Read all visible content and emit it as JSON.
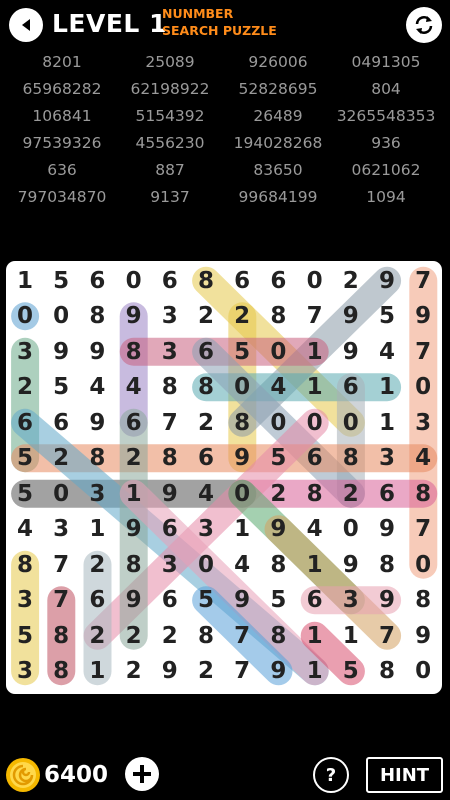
{
  "header": {
    "level_word": "LEVEL",
    "level_number": "1",
    "title_line1": "NUNMBER",
    "title_line2": "SEARCH PUZZLE"
  },
  "targets": [
    [
      "8201",
      "25089",
      "926006",
      "0491305"
    ],
    [
      "65968282",
      "62198922",
      "52828695",
      "804"
    ],
    [
      "106841",
      "5154392",
      "26489",
      "3265548353"
    ],
    [
      "97539326",
      "4556230",
      "194028268",
      "936"
    ],
    [
      "636",
      "887",
      "83650",
      "0621062"
    ],
    [
      "797034870",
      "9137",
      "99684199",
      "1094"
    ]
  ],
  "grid": [
    [
      "1",
      "5",
      "6",
      "0",
      "6",
      "8",
      "6",
      "6",
      "0",
      "2",
      "9",
      "7"
    ],
    [
      "0",
      "0",
      "8",
      "9",
      "3",
      "2",
      "2",
      "8",
      "7",
      "9",
      "5",
      "9"
    ],
    [
      "3",
      "9",
      "9",
      "8",
      "3",
      "6",
      "5",
      "0",
      "1",
      "9",
      "4",
      "7"
    ],
    [
      "2",
      "5",
      "4",
      "4",
      "8",
      "8",
      "0",
      "4",
      "1",
      "6",
      "1",
      "0"
    ],
    [
      "6",
      "6",
      "9",
      "6",
      "7",
      "2",
      "8",
      "0",
      "0",
      "0",
      "1",
      "3"
    ],
    [
      "5",
      "2",
      "8",
      "2",
      "8",
      "6",
      "9",
      "5",
      "6",
      "8",
      "3",
      "4"
    ],
    [
      "5",
      "0",
      "3",
      "1",
      "9",
      "4",
      "0",
      "2",
      "8",
      "2",
      "6",
      "8"
    ],
    [
      "4",
      "3",
      "1",
      "9",
      "6",
      "3",
      "1",
      "9",
      "4",
      "0",
      "9",
      "7"
    ],
    [
      "8",
      "7",
      "2",
      "8",
      "3",
      "0",
      "4",
      "8",
      "1",
      "9",
      "8",
      "0"
    ],
    [
      "3",
      "7",
      "6",
      "9",
      "6",
      "5",
      "9",
      "5",
      "6",
      "3",
      "9",
      "8"
    ],
    [
      "5",
      "8",
      "2",
      "2",
      "2",
      "8",
      "7",
      "8",
      "1",
      "1",
      "7",
      "9"
    ],
    [
      "3",
      "8",
      "1",
      "2",
      "9",
      "2",
      "7",
      "9",
      "1",
      "5",
      "8",
      "0"
    ]
  ],
  "highlights": [
    {
      "color": "#e6c84a",
      "from": [
        0,
        5
      ],
      "to": [
        4,
        9
      ]
    },
    {
      "color": "#f0a080",
      "from": [
        0,
        11
      ],
      "to": [
        8,
        11
      ]
    },
    {
      "color": "#5a9ed0",
      "from": [
        1,
        0
      ],
      "to": [
        1,
        0
      ]
    },
    {
      "color": "#9a84c4",
      "from": [
        1,
        3
      ],
      "to": [
        4,
        3
      ]
    },
    {
      "color": "#e6c84a",
      "from": [
        1,
        6
      ],
      "to": [
        5,
        6
      ]
    },
    {
      "color": "#8a9aa8",
      "from": [
        0,
        10
      ],
      "to": [
        4,
        6
      ]
    },
    {
      "color": "#c86080",
      "from": [
        2,
        3
      ],
      "to": [
        2,
        8
      ]
    },
    {
      "color": "#6aaa88",
      "from": [
        2,
        0
      ],
      "to": [
        5,
        0
      ]
    },
    {
      "color": "#5aaab0",
      "from": [
        3,
        5
      ],
      "to": [
        3,
        10
      ]
    },
    {
      "color": "#a8b0b8",
      "from": [
        3,
        9
      ],
      "to": [
        6,
        9
      ]
    },
    {
      "color": "#8aa0b4",
      "from": [
        2,
        5
      ],
      "to": [
        6,
        9
      ]
    },
    {
      "color": "#e88a60",
      "from": [
        5,
        0
      ],
      "to": [
        5,
        11
      ]
    },
    {
      "color": "#d86098",
      "from": [
        6,
        6
      ],
      "to": [
        6,
        11
      ]
    },
    {
      "color": "#555555",
      "from": [
        6,
        0
      ],
      "to": [
        6,
        6
      ]
    },
    {
      "color": "#60a8c8",
      "from": [
        4,
        0
      ],
      "to": [
        11,
        8
      ]
    },
    {
      "color": "#e68aa8",
      "from": [
        4,
        8
      ],
      "to": [
        10,
        2
      ]
    },
    {
      "color": "#8aa89a",
      "from": [
        4,
        3
      ],
      "to": [
        10,
        3
      ]
    },
    {
      "color": "#5aaa70",
      "from": [
        6,
        6
      ],
      "to": [
        9,
        9
      ]
    },
    {
      "color": "#e8a0b8",
      "from": [
        6,
        3
      ],
      "to": [
        11,
        8
      ]
    },
    {
      "color": "#e6c84a",
      "from": [
        8,
        0
      ],
      "to": [
        11,
        0
      ]
    },
    {
      "color": "#c05060",
      "from": [
        9,
        1
      ],
      "to": [
        11,
        1
      ]
    },
    {
      "color": "#d4a060",
      "from": [
        7,
        7
      ],
      "to": [
        10,
        10
      ]
    },
    {
      "color": "#a8b8c0",
      "from": [
        8,
        2
      ],
      "to": [
        11,
        2
      ]
    },
    {
      "color": "#e8a0b0",
      "from": [
        9,
        8
      ],
      "to": [
        9,
        10
      ]
    },
    {
      "color": "#5aa0d8",
      "from": [
        9,
        5
      ],
      "to": [
        11,
        7
      ]
    },
    {
      "color": "#d85070",
      "from": [
        10,
        8
      ],
      "to": [
        11,
        9
      ]
    }
  ],
  "footer": {
    "coins": "6400",
    "help_label": "?",
    "hint_label": "HINT"
  },
  "colors": {
    "title_accent": "#ff8c1a",
    "target_text": "#9a9a9a",
    "board_bg": "#ffffff"
  }
}
